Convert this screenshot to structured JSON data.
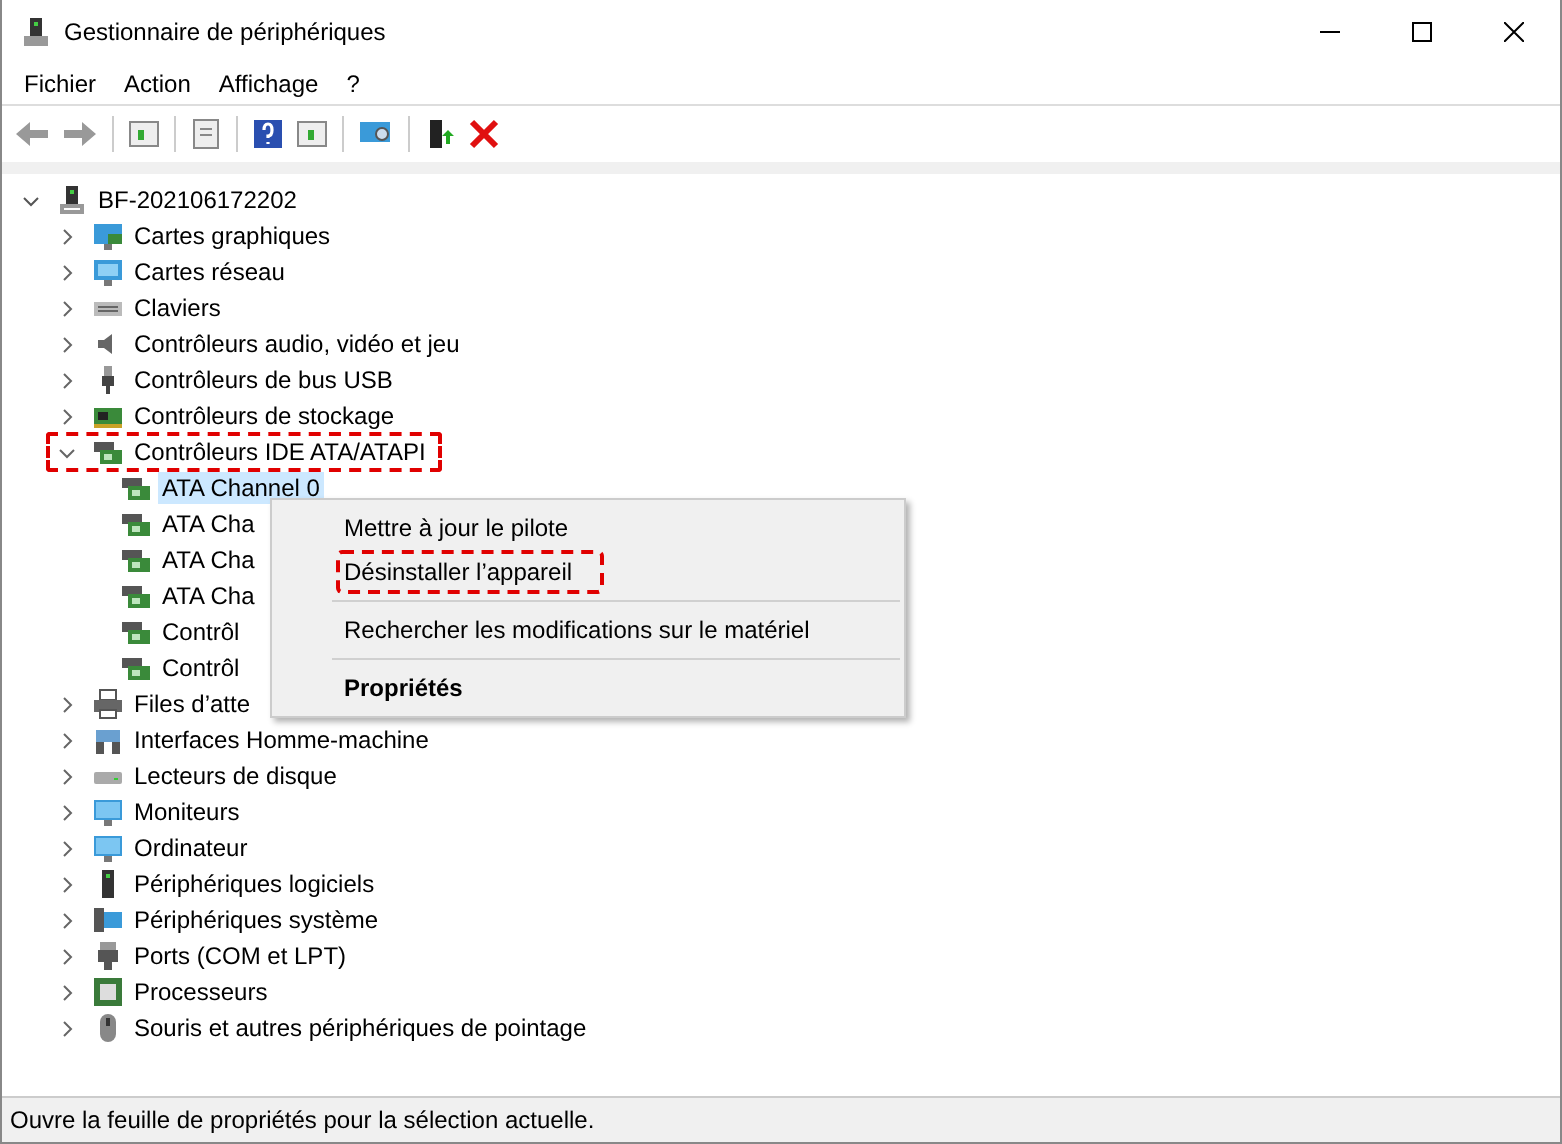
{
  "window": {
    "title": "Gestionnaire de périphériques"
  },
  "menu": [
    "Fichier",
    "Action",
    "Affichage",
    "?"
  ],
  "tree": {
    "label": "BF-202106172202",
    "kind": "computer",
    "expanded": true,
    "children": [
      {
        "label": "Cartes graphiques",
        "kind": "display",
        "expanded": false,
        "highlighted": false
      },
      {
        "label": "Cartes réseau",
        "kind": "network",
        "expanded": false,
        "highlighted": false
      },
      {
        "label": "Claviers",
        "kind": "keyboard",
        "expanded": false,
        "highlighted": false
      },
      {
        "label": "Contrôleurs audio, vidéo et jeu",
        "kind": "audio",
        "expanded": false,
        "highlighted": false
      },
      {
        "label": "Contrôleurs de bus USB",
        "kind": "usb",
        "expanded": false,
        "highlighted": false
      },
      {
        "label": "Contrôleurs de stockage",
        "kind": "storage",
        "expanded": false,
        "highlighted": false
      },
      {
        "label": "Contrôleurs IDE ATA/ATAPI",
        "kind": "ide",
        "expanded": true,
        "highlighted": true,
        "children": [
          {
            "label": "ATA Channel 0",
            "kind": "ide",
            "selected": true
          },
          {
            "label": "ATA Cha",
            "kind": "ide",
            "selected": false
          },
          {
            "label": "ATA Cha",
            "kind": "ide",
            "selected": false
          },
          {
            "label": "ATA Cha",
            "kind": "ide",
            "selected": false
          },
          {
            "label": "Contrôl",
            "kind": "ide",
            "selected": false
          },
          {
            "label": "Contrôl",
            "kind": "ide",
            "selected": false
          }
        ]
      },
      {
        "label": "Files d’atte",
        "kind": "printer",
        "expanded": false,
        "highlighted": false
      },
      {
        "label": "Interfaces Homme-machine",
        "kind": "hid",
        "expanded": false,
        "highlighted": false
      },
      {
        "label": "Lecteurs de disque",
        "kind": "disk",
        "expanded": false,
        "highlighted": false
      },
      {
        "label": "Moniteurs",
        "kind": "monitor",
        "expanded": false,
        "highlighted": false
      },
      {
        "label": "Ordinateur",
        "kind": "monitor",
        "expanded": false,
        "highlighted": false
      },
      {
        "label": "Périphériques logiciels",
        "kind": "software",
        "expanded": false,
        "highlighted": false
      },
      {
        "label": "Périphériques système",
        "kind": "system",
        "expanded": false,
        "highlighted": false
      },
      {
        "label": "Ports (COM et LPT)",
        "kind": "port",
        "expanded": false,
        "highlighted": false
      },
      {
        "label": "Processeurs",
        "kind": "cpu",
        "expanded": false,
        "highlighted": false
      },
      {
        "label": "Souris et autres périphériques de pointage",
        "kind": "mouse",
        "expanded": false,
        "highlighted": false
      }
    ]
  },
  "context_menu": [
    {
      "kind": "item",
      "label": "Mettre à jour le pilote",
      "bold": false,
      "highlighted": false
    },
    {
      "kind": "item",
      "label": "Désinstaller l’appareil",
      "bold": false,
      "highlighted": true
    },
    {
      "kind": "separator"
    },
    {
      "kind": "item",
      "label": "Rechercher les modifications sur le matériel",
      "bold": false,
      "highlighted": false
    },
    {
      "kind": "separator"
    },
    {
      "kind": "item",
      "label": "Propriétés",
      "bold": true,
      "highlighted": false
    }
  ],
  "status_bar": "Ouvre la feuille de propriétés pour la sélection actuelle."
}
